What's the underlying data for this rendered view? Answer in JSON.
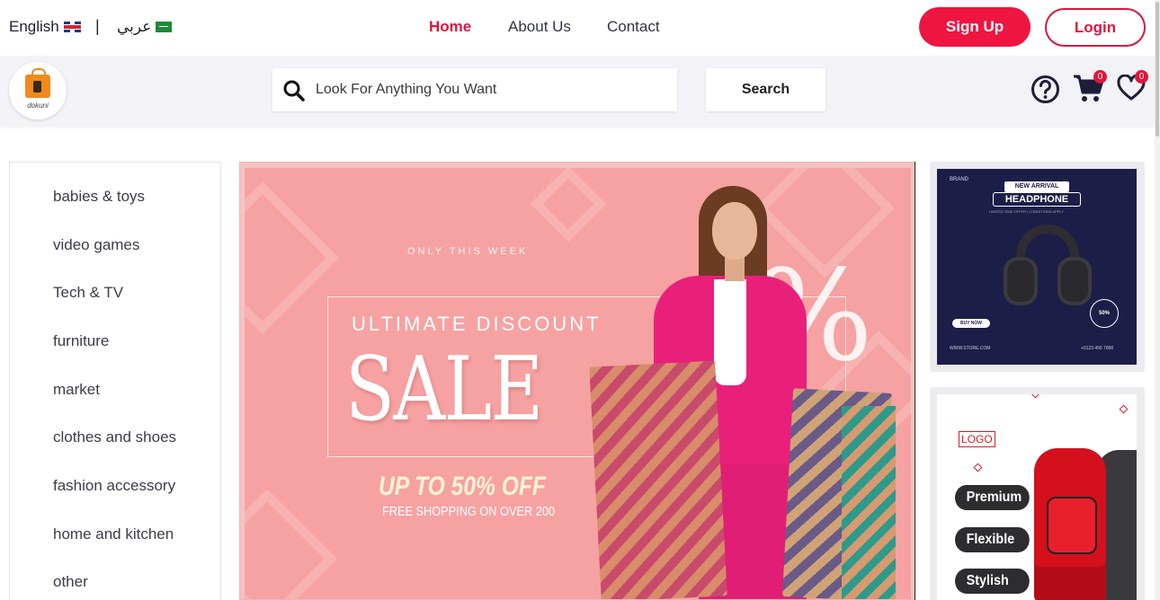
{
  "topbar": {
    "lang_english": "English",
    "lang_separator": "|",
    "lang_arabic": "عربي",
    "nav": {
      "home": "Home",
      "about": "About Us",
      "contact": "Contact"
    },
    "signup_label": "Sign Up",
    "login_label": "Login"
  },
  "header": {
    "logo_text": "dokuni",
    "search_placeholder": "Look For Anything You Want",
    "search_button": "Search",
    "cart_count": "0",
    "favorites_count": "0"
  },
  "categories": [
    "babies & toys",
    "video games",
    "Tech & TV",
    "furniture",
    "market",
    "clothes and shoes",
    "fashion accessory",
    "home and kitchen",
    "other"
  ],
  "hero": {
    "tag": "ONLY THIS WEEK",
    "title": "ULTIMATE DISCOUNT",
    "sale": "SALE",
    "offer": "UP TO 50% OFF",
    "shipping": "FREE SHOPPING ON OVER 200",
    "percent_symbol": "%"
  },
  "ad_headphone": {
    "brand": "BRAND",
    "badge": "NEW ARRIVAL",
    "title": "HEADPHONE",
    "small_print": "LIMITED TIME OFFER | CONDITIONS APPLY",
    "buy_label": "BUY NOW",
    "discount": "50%",
    "website": "WWW.STORE.COM",
    "phone": "+0123 456 7890"
  },
  "ad_backpack": {
    "logo": "LOGO",
    "features": [
      "Premium",
      "Flexible",
      "Stylish"
    ]
  },
  "colors": {
    "accent": "#e0153c",
    "signup_bg": "#ee1540",
    "strip_bg": "#f2f2f7",
    "hero_bg": "#f6a2a2",
    "ad_dark": "#1d1e47"
  },
  "icons": [
    "search-icon",
    "help-icon",
    "cart-icon",
    "heart-icon",
    "uk-flag-icon",
    "saudi-flag-icon"
  ]
}
